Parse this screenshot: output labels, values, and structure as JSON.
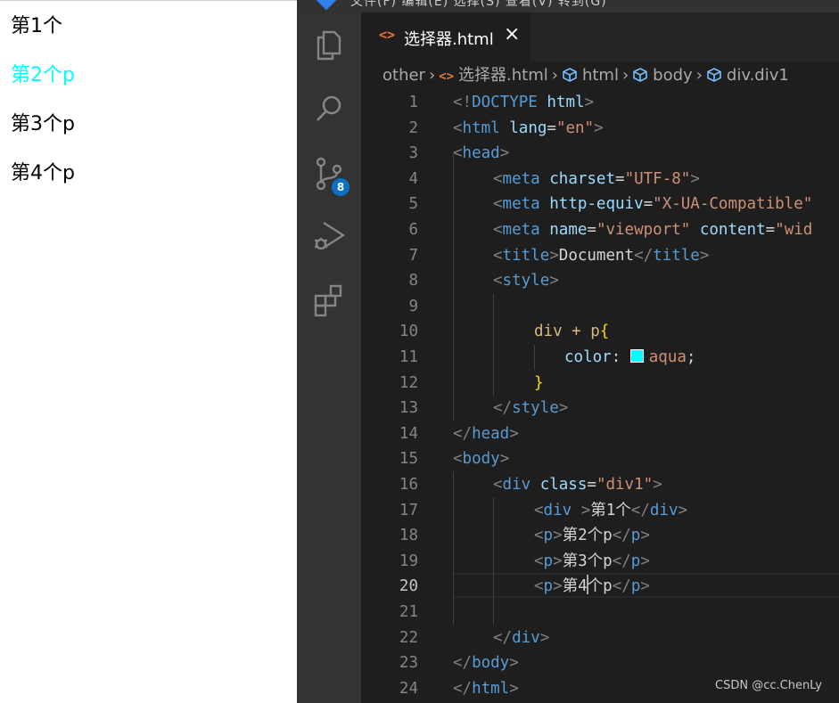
{
  "preview": {
    "lines": [
      "第1个",
      "第2个p",
      "第3个p",
      "第4个p"
    ],
    "highlight_color": "#00ffff"
  },
  "titlebar": {
    "menu_text": "文件(F)  编辑(E)  选择(S)  查看(V)  转到(G)"
  },
  "activity_bar": {
    "items": [
      "explorer-icon",
      "search-icon",
      "source-control-icon",
      "run-debug-icon",
      "extensions-icon"
    ],
    "source_control_badge": "8",
    "badge_color": "#0e70c0"
  },
  "tab": {
    "icon": "<>",
    "label": "选择器.html",
    "close": "×"
  },
  "breadcrumb": {
    "items": [
      "other",
      "选择器.html",
      "html",
      "body",
      "div.div1"
    ]
  },
  "editor": {
    "active_line": 20,
    "line_numbers": [
      "1",
      "2",
      "3",
      "4",
      "5",
      "6",
      "7",
      "8",
      "9",
      "10",
      "11",
      "12",
      "13",
      "14",
      "15",
      "16",
      "17",
      "18",
      "19",
      "20",
      "21",
      "22",
      "23",
      "24"
    ],
    "line1": {
      "open": "<!",
      "tag": "DOCTYPE",
      "sp": " ",
      "attr": "html",
      "close": ">"
    },
    "line2": {
      "open": "<",
      "tag": "html",
      "sp": " ",
      "attr": "lang",
      "eq": "=",
      "val": "\"en\"",
      "close": ">"
    },
    "line3": {
      "open": "<",
      "tag": "head",
      "close": ">"
    },
    "line4": {
      "open": "<",
      "tag": "meta",
      "sp": " ",
      "attr": "charset",
      "eq": "=",
      "val": "\"UTF-8\"",
      "close": ">"
    },
    "line5": {
      "open": "<",
      "tag": "meta",
      "sp": " ",
      "attr": "http-equiv",
      "eq": "=",
      "val": "\"X-UA-Compatible\""
    },
    "line6": {
      "open": "<",
      "tag": "meta",
      "sp": " ",
      "attr": "name",
      "eq": "=",
      "val": "\"viewport\"",
      "sp2": " ",
      "attr2": "content",
      "eq2": "=",
      "val2": "\"wid"
    },
    "line7": {
      "open": "<",
      "tag": "title",
      "close": ">",
      "text": "Document",
      "open2": "</",
      "tag2": "title",
      "close2": ">"
    },
    "line8": {
      "open": "<",
      "tag": "style",
      "close": ">"
    },
    "line10": {
      "sel": "div + p",
      "brace": "{"
    },
    "line11": {
      "prop": "color",
      "colon": ": ",
      "val": "aqua",
      "semi": ";"
    },
    "line12": {
      "brace": "}"
    },
    "line13": {
      "open": "</",
      "tag": "style",
      "close": ">"
    },
    "line14": {
      "open": "</",
      "tag": "head",
      "close": ">"
    },
    "line15": {
      "open": "<",
      "tag": "body",
      "close": ">"
    },
    "line16": {
      "open": "<",
      "tag": "div",
      "sp": " ",
      "attr": "class",
      "eq": "=",
      "val": "\"div1\"",
      "close": ">"
    },
    "line17": {
      "open": "<",
      "tag": "div",
      "sp": " ",
      "close": ">",
      "text": "第1个",
      "open2": "</",
      "tag2": "div",
      "close2": ">"
    },
    "line18": {
      "open": "<",
      "tag": "p",
      "close": ">",
      "text": "第2个p",
      "open2": "</",
      "tag2": "p",
      "close2": ">"
    },
    "line19": {
      "open": "<",
      "tag": "p",
      "close": ">",
      "text": "第3个p",
      "open2": "</",
      "tag2": "p",
      "close2": ">"
    },
    "line20": {
      "open": "<",
      "tag": "p",
      "close": ">",
      "text_a": "第4",
      "text_b": "个p",
      "open2": "</",
      "tag2": "p",
      "close2": ">"
    },
    "line22": {
      "open": "</",
      "tag": "div",
      "close": ">"
    },
    "line23": {
      "open": "</",
      "tag": "body",
      "close": ">"
    },
    "line24": {
      "open": "</",
      "tag": "html",
      "close": ">"
    }
  },
  "watermark": "CSDN @cc.ChenLy"
}
